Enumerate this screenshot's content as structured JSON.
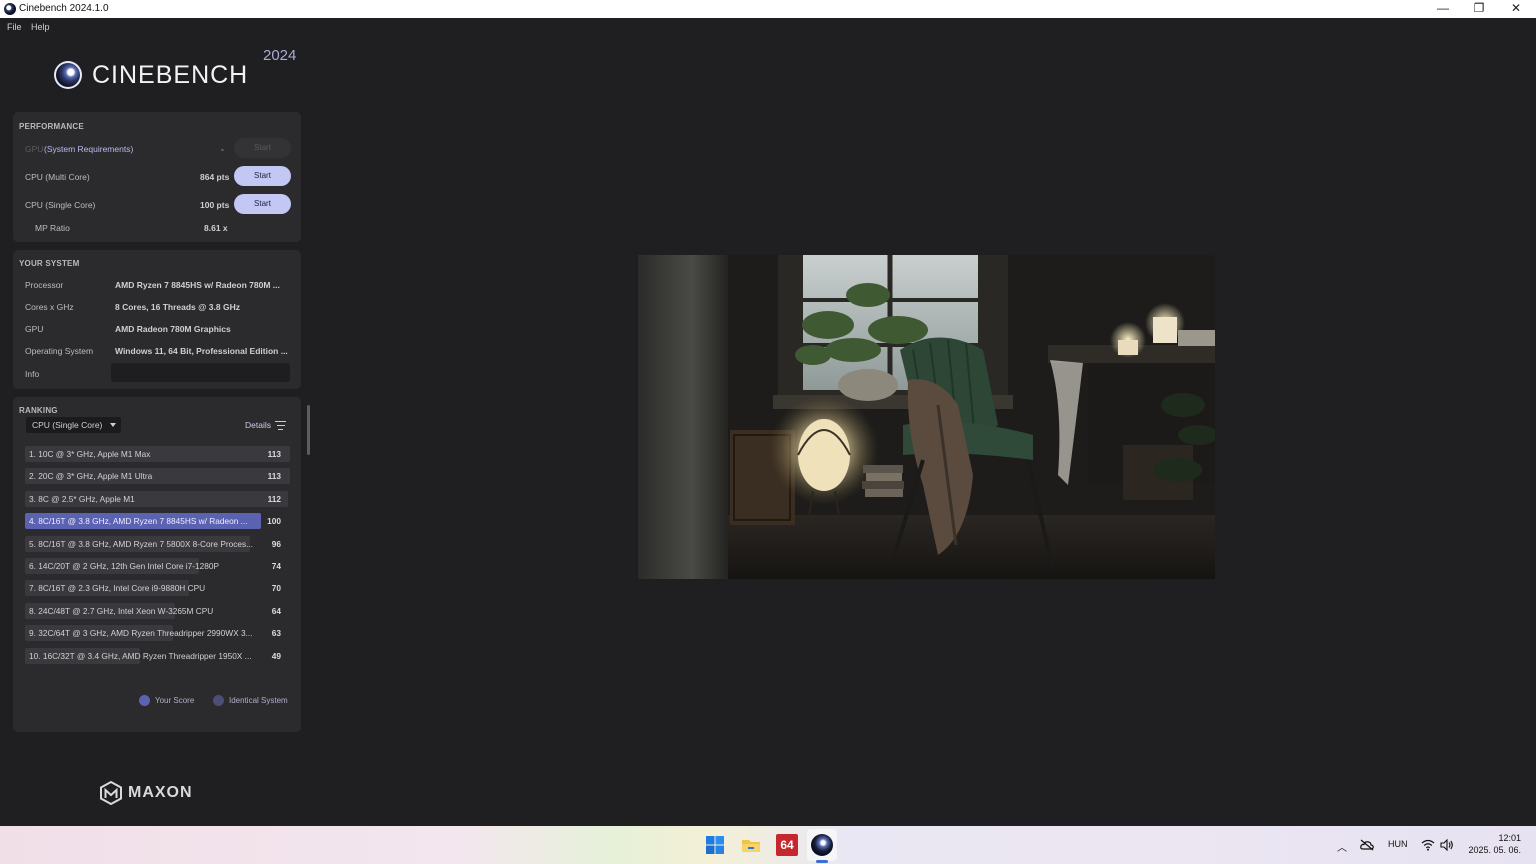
{
  "window": {
    "title": "Cinebench 2024.1.0",
    "minimize_glyph": "—",
    "maximize_glyph": "❐",
    "close_glyph": "✕"
  },
  "menu": {
    "file": "File",
    "help": "Help"
  },
  "logo": {
    "word": "CINEBENCH",
    "year": "2024"
  },
  "performance": {
    "title": "PERFORMANCE",
    "gpu_label": "GPU",
    "gpu_link": "(System Requirements)",
    "gpu_value": "-",
    "gpu_button": "Start",
    "multi_label": "CPU (Multi Core)",
    "multi_value": "864 pts",
    "multi_button": "Start",
    "single_label": "CPU (Single Core)",
    "single_value": "100 pts",
    "single_button": "Start",
    "mp_label": "MP Ratio",
    "mp_value": "8.61 x"
  },
  "system": {
    "title": "YOUR SYSTEM",
    "rows": [
      {
        "label": "Processor",
        "value": "AMD Ryzen 7 8845HS w/ Radeon 780M ..."
      },
      {
        "label": "Cores x GHz",
        "value": "8 Cores, 16 Threads @ 3.8 GHz"
      },
      {
        "label": "GPU",
        "value": "AMD Radeon 780M Graphics"
      },
      {
        "label": "Operating System",
        "value": "Windows 11, 64 Bit, Professional Edition ..."
      },
      {
        "label": "Info",
        "value": ""
      }
    ]
  },
  "ranking": {
    "title": "RANKING",
    "mode": "CPU (Single Core)",
    "details": "Details",
    "rows": [
      {
        "text": "1. 10C @ 3* GHz, Apple M1 Max",
        "score": "113",
        "mine": false
      },
      {
        "text": "2. 20C @ 3* GHz, Apple M1 Ultra",
        "score": "113",
        "mine": false
      },
      {
        "text": "3. 8C @ 2.5* GHz, Apple M1",
        "score": "112",
        "mine": false
      },
      {
        "text": "4. 8C/16T @ 3.8 GHz, AMD Ryzen 7 8845HS w/ Radeon ...",
        "score": "100",
        "mine": true
      },
      {
        "text": "5. 8C/16T @ 3.8 GHz, AMD Ryzen 7 5800X 8-Core Proces...",
        "score": "96",
        "mine": false
      },
      {
        "text": "6. 14C/20T @ 2 GHz, 12th Gen Intel Core i7-1280P",
        "score": "74",
        "mine": false
      },
      {
        "text": "7. 8C/16T @ 2.3 GHz, Intel Core i9-9880H CPU",
        "score": "70",
        "mine": false
      },
      {
        "text": "8. 24C/48T @ 2.7 GHz, Intel Xeon W-3265M CPU",
        "score": "64",
        "mine": false
      },
      {
        "text": "9. 32C/64T @ 3 GHz, AMD Ryzen Threadripper 2990WX 3...",
        "score": "63",
        "mine": false
      },
      {
        "text": "10. 16C/32T @ 3.4 GHz, AMD Ryzen Threadripper 1950X ...",
        "score": "49",
        "mine": false
      }
    ],
    "legend_your": "Your Score",
    "legend_identical": "Identical System",
    "your_color": "#5b62b2",
    "identical_color": "#4b4e75"
  },
  "brand": {
    "maxon": "MAXON"
  },
  "taskbar": {
    "icons": [
      "windows-start-icon",
      "file-explorer-icon",
      "aida64-icon",
      "cinebench-icon"
    ],
    "aida_label": "64",
    "tray_lang": "HUN",
    "time": "12:01",
    "date": "2025. 05. 06."
  }
}
